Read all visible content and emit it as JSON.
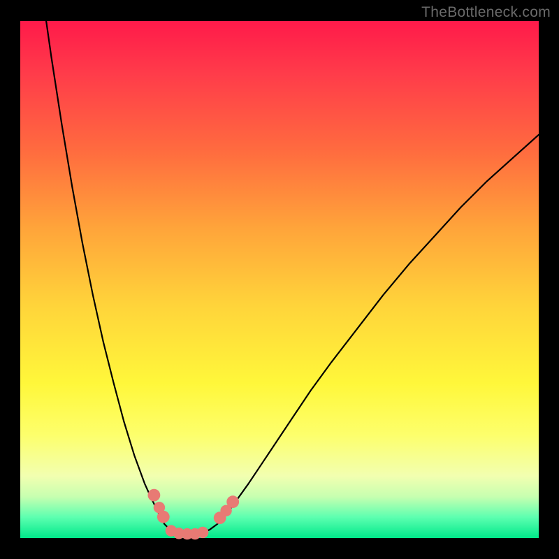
{
  "watermark": "TheBottleneck.com",
  "colors": {
    "curve": "#000000",
    "marker_fill": "#e87a74",
    "marker_stroke": "#b85a54",
    "gradient_top": "#ff1a4a",
    "gradient_bottom": "#00e88a",
    "frame": "#000000"
  },
  "chart_data": {
    "type": "line",
    "title": "",
    "xlabel": "",
    "ylabel": "",
    "xlim": [
      0,
      100
    ],
    "ylim": [
      0,
      100
    ],
    "grid": false,
    "curve": [
      {
        "x": 5.0,
        "y": 100.0
      },
      {
        "x": 6.0,
        "y": 93.0
      },
      {
        "x": 8.0,
        "y": 80.0
      },
      {
        "x": 10.0,
        "y": 68.0
      },
      {
        "x": 12.0,
        "y": 57.0
      },
      {
        "x": 14.0,
        "y": 47.0
      },
      {
        "x": 16.0,
        "y": 38.0
      },
      {
        "x": 18.0,
        "y": 30.0
      },
      {
        "x": 20.0,
        "y": 22.5
      },
      {
        "x": 22.0,
        "y": 16.0
      },
      {
        "x": 24.0,
        "y": 10.5
      },
      {
        "x": 25.0,
        "y": 8.3
      },
      {
        "x": 26.0,
        "y": 6.2
      },
      {
        "x": 27.0,
        "y": 4.2
      },
      {
        "x": 27.8,
        "y": 2.7
      },
      {
        "x": 29.0,
        "y": 1.5
      },
      {
        "x": 30.0,
        "y": 1.0
      },
      {
        "x": 31.0,
        "y": 0.8
      },
      {
        "x": 33.0,
        "y": 0.8
      },
      {
        "x": 35.0,
        "y": 1.0
      },
      {
        "x": 36.5,
        "y": 1.6
      },
      {
        "x": 38.0,
        "y": 2.7
      },
      {
        "x": 39.5,
        "y": 4.3
      },
      {
        "x": 41.0,
        "y": 6.3
      },
      {
        "x": 44.0,
        "y": 10.5
      },
      {
        "x": 48.0,
        "y": 16.5
      },
      {
        "x": 52.0,
        "y": 22.5
      },
      {
        "x": 56.0,
        "y": 28.5
      },
      {
        "x": 60.0,
        "y": 34.0
      },
      {
        "x": 65.0,
        "y": 40.5
      },
      {
        "x": 70.0,
        "y": 47.0
      },
      {
        "x": 75.0,
        "y": 53.0
      },
      {
        "x": 80.0,
        "y": 58.5
      },
      {
        "x": 85.0,
        "y": 64.0
      },
      {
        "x": 90.0,
        "y": 69.0
      },
      {
        "x": 95.0,
        "y": 73.5
      },
      {
        "x": 100.0,
        "y": 78.0
      }
    ],
    "markers": [
      {
        "x": 25.8,
        "y": 8.3,
        "r": 1.2
      },
      {
        "x": 26.8,
        "y": 5.9,
        "r": 1.1
      },
      {
        "x": 27.6,
        "y": 4.1,
        "r": 1.2
      },
      {
        "x": 29.1,
        "y": 1.4,
        "r": 1.1
      },
      {
        "x": 30.6,
        "y": 0.9,
        "r": 1.1
      },
      {
        "x": 32.2,
        "y": 0.8,
        "r": 1.1
      },
      {
        "x": 33.7,
        "y": 0.8,
        "r": 1.1
      },
      {
        "x": 35.2,
        "y": 1.1,
        "r": 1.1
      },
      {
        "x": 38.5,
        "y": 3.9,
        "r": 1.2
      },
      {
        "x": 39.7,
        "y": 5.3,
        "r": 1.1
      },
      {
        "x": 41.0,
        "y": 7.0,
        "r": 1.2
      }
    ]
  }
}
